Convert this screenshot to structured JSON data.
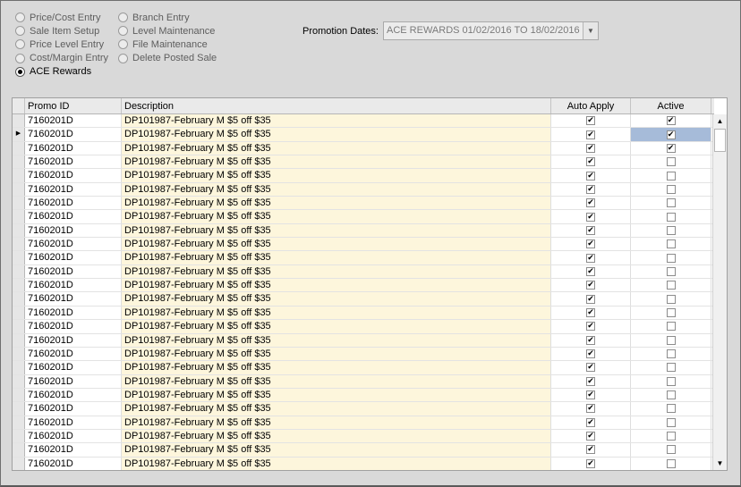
{
  "options": {
    "col1": [
      {
        "label": "Price/Cost Entry",
        "selected": false
      },
      {
        "label": "Sale Item Setup",
        "selected": false
      },
      {
        "label": "Price Level Entry",
        "selected": false
      },
      {
        "label": "Cost/Margin Entry",
        "selected": false
      },
      {
        "label": "ACE Rewards",
        "selected": true
      }
    ],
    "col2": [
      {
        "label": "Branch Entry",
        "selected": false
      },
      {
        "label": "Level Maintenance",
        "selected": false
      },
      {
        "label": "File Maintenance",
        "selected": false
      },
      {
        "label": "Delete Posted Sale",
        "selected": false
      }
    ]
  },
  "promotion": {
    "label": "Promotion Dates:",
    "value": "ACE REWARDS 01/02/2016 TO 18/02/2016",
    "dropdown_icon": "chevron-down-icon"
  },
  "grid": {
    "columns": [
      "Promo ID",
      "Description",
      "Auto Apply",
      "Active"
    ],
    "current_row_index": 1,
    "rows": [
      {
        "promo_id": "7160201D",
        "description": "DP101987-February M $5 off $35",
        "auto_apply": true,
        "active": true
      },
      {
        "promo_id": "7160201D",
        "description": "DP101987-February M $5 off $35",
        "auto_apply": true,
        "active": true
      },
      {
        "promo_id": "7160201D",
        "description": "DP101987-February M $5 off $35",
        "auto_apply": true,
        "active": true
      },
      {
        "promo_id": "7160201D",
        "description": "DP101987-February M $5 off $35",
        "auto_apply": true,
        "active": false
      },
      {
        "promo_id": "7160201D",
        "description": "DP101987-February M $5 off $35",
        "auto_apply": true,
        "active": false
      },
      {
        "promo_id": "7160201D",
        "description": "DP101987-February M $5 off $35",
        "auto_apply": true,
        "active": false
      },
      {
        "promo_id": "7160201D",
        "description": "DP101987-February M $5 off $35",
        "auto_apply": true,
        "active": false
      },
      {
        "promo_id": "7160201D",
        "description": "DP101987-February M $5 off $35",
        "auto_apply": true,
        "active": false
      },
      {
        "promo_id": "7160201D",
        "description": "DP101987-February M $5 off $35",
        "auto_apply": true,
        "active": false
      },
      {
        "promo_id": "7160201D",
        "description": "DP101987-February M $5 off $35",
        "auto_apply": true,
        "active": false
      },
      {
        "promo_id": "7160201D",
        "description": "DP101987-February M $5 off $35",
        "auto_apply": true,
        "active": false
      },
      {
        "promo_id": "7160201D",
        "description": "DP101987-February M $5 off $35",
        "auto_apply": true,
        "active": false
      },
      {
        "promo_id": "7160201D",
        "description": "DP101987-February M $5 off $35",
        "auto_apply": true,
        "active": false
      },
      {
        "promo_id": "7160201D",
        "description": "DP101987-February M $5 off $35",
        "auto_apply": true,
        "active": false
      },
      {
        "promo_id": "7160201D",
        "description": "DP101987-February M $5 off $35",
        "auto_apply": true,
        "active": false
      },
      {
        "promo_id": "7160201D",
        "description": "DP101987-February M $5 off $35",
        "auto_apply": true,
        "active": false
      },
      {
        "promo_id": "7160201D",
        "description": "DP101987-February M $5 off $35",
        "auto_apply": true,
        "active": false
      },
      {
        "promo_id": "7160201D",
        "description": "DP101987-February M $5 off $35",
        "auto_apply": true,
        "active": false
      },
      {
        "promo_id": "7160201D",
        "description": "DP101987-February M $5 off $35",
        "auto_apply": true,
        "active": false
      },
      {
        "promo_id": "7160201D",
        "description": "DP101987-February M $5 off $35",
        "auto_apply": true,
        "active": false
      },
      {
        "promo_id": "7160201D",
        "description": "DP101987-February M $5 off $35",
        "auto_apply": true,
        "active": false
      },
      {
        "promo_id": "7160201D",
        "description": "DP101987-February M $5 off $35",
        "auto_apply": true,
        "active": false
      },
      {
        "promo_id": "7160201D",
        "description": "DP101987-February M $5 off $35",
        "auto_apply": true,
        "active": false
      },
      {
        "promo_id": "7160201D",
        "description": "DP101987-February M $5 off $35",
        "auto_apply": true,
        "active": false
      },
      {
        "promo_id": "7160201D",
        "description": "DP101987-February M $5 off $35",
        "auto_apply": true,
        "active": false
      },
      {
        "promo_id": "7160201D",
        "description": "DP101987-February M $5 off $35",
        "auto_apply": true,
        "active": false
      }
    ]
  },
  "icons": {
    "row_indicator": "row-pointer-icon",
    "scroll_up": "scroll-up-icon",
    "scroll_down": "scroll-down-icon",
    "checkmark": "checkmark-icon"
  }
}
